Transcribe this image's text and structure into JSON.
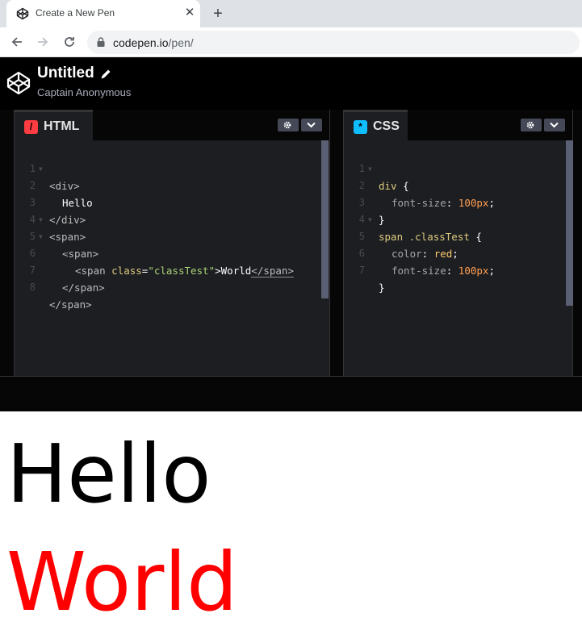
{
  "browser": {
    "tab_title": "Create a New Pen",
    "tab_close": "✕",
    "new_tab": "+",
    "url_host": "codepen.io",
    "url_path": "/pen/"
  },
  "header": {
    "title": "Untitled",
    "author": "Captain Anonymous"
  },
  "html_editor": {
    "label": "HTML",
    "badge": "/",
    "line_numbers": [
      "1",
      "2",
      "3",
      "4",
      "5",
      "6",
      "7",
      "8"
    ]
  },
  "css_editor": {
    "label": "CSS",
    "badge": "*",
    "line_numbers": [
      "1",
      "2",
      "3",
      "4",
      "5",
      "6",
      "7"
    ]
  },
  "code": {
    "h1_open": "<div>",
    "h2_text": "Hello",
    "h3_close": "</div>",
    "h4_open": "<span>",
    "h5_open": "<span>",
    "h6_a": "<span ",
    "h6_attr": "class",
    "h6_eq": "=",
    "h6_str": "\"classTest\"",
    "h6_gt": ">",
    "h6_text": "World",
    "h6_close": "</span>",
    "h7_close": "</span>",
    "h8_close": "</span>",
    "c1_sel": "div",
    "c1_brace": " {",
    "c2_prop": "font-size",
    "c2_colon": ": ",
    "c2_num": "100px",
    "c2_semi": ";",
    "c3_brace": "}",
    "c4_sel": "span .classTest",
    "c4_brace": " {",
    "c5_prop": "color",
    "c5_colon": ": ",
    "c5_val": "red",
    "c5_semi": ";",
    "c6_prop": "font-size",
    "c6_colon": ": ",
    "c6_num": "100px",
    "c6_semi": ";",
    "c7_brace": "}"
  },
  "preview": {
    "line1": "Hello",
    "line2": "World"
  },
  "colors": {
    "accent_html": "#ff3c41",
    "accent_css": "#0ebeff",
    "world_text": "#ff0000"
  }
}
